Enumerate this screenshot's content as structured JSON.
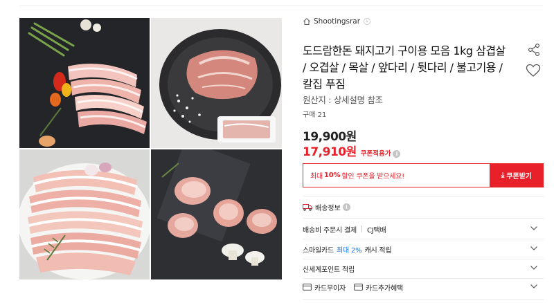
{
  "seller": {
    "name": "Shootingsrar",
    "icon": "home-icon"
  },
  "product": {
    "title": "도드람한돈 돼지고기 구이용 모음 1kg 삼겹살 / 오겹살 / 목살 / 앞다리 / 뒷다리 / 불고기용 / 칼집 푸짐",
    "origin": "원산지 : 상세설명 참조",
    "buy_count": "구매 21",
    "price": "19,900원",
    "sale_price": "17,910원",
    "coupon_applied": "쿠폰적용가"
  },
  "coupon": {
    "msg_prefix": "최대",
    "msg_bold": "10%",
    "msg_suffix": "할인 쿠폰을 받으세요!",
    "button": "쿠폰받기"
  },
  "shipping": {
    "heading": "배송정보",
    "rows": [
      {
        "label": "배송비 주문시 결제",
        "value": "CJ택배"
      },
      {
        "label_prefix": "스마일카드",
        "highlight": "최대 2%",
        "label_suffix": "캐시 적립"
      },
      {
        "label": "신세계포인트 적립"
      },
      {
        "left": "카드무이자",
        "right": "카드추가혜택"
      }
    ]
  },
  "colors": {
    "accent": "#e8202a",
    "link": "#1a73e8"
  }
}
